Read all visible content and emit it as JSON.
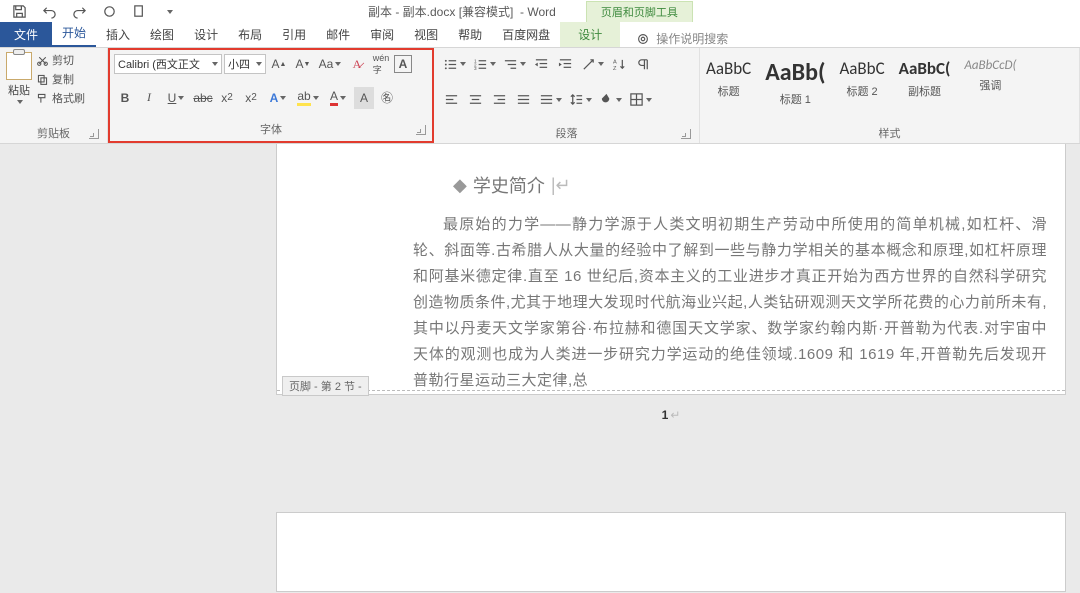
{
  "qat": {
    "save": "save-icon",
    "undo": "undo-icon",
    "redo": "redo-icon",
    "touch": "touch-icon",
    "new": "new-icon"
  },
  "titlebar": {
    "filename": "副本 - 副本.docx",
    "mode": "[兼容模式]",
    "app": "Word",
    "context_tool_group": "页眉和页脚工具"
  },
  "tabs": {
    "file": "文件",
    "home": "开始",
    "insert": "插入",
    "draw": "绘图",
    "design": "设计",
    "layout": "布局",
    "references": "引用",
    "mailings": "邮件",
    "review": "审阅",
    "view": "视图",
    "help": "帮助",
    "baidu": "百度网盘",
    "hf_design": "设计",
    "tell_me": "操作说明搜索"
  },
  "ribbon": {
    "clipboard": {
      "paste": "粘贴",
      "cut": "剪切",
      "copy": "复制",
      "painter": "格式刷",
      "label": "剪贴板"
    },
    "font": {
      "name": "Calibri (西文正文",
      "size": "小四",
      "grow": "A",
      "shrink": "A",
      "case": "Aa",
      "clear": "清",
      "pinyin": "拼",
      "border": "A",
      "bold": "B",
      "italic": "I",
      "underline": "U",
      "strike": "abc",
      "sub": "x₂",
      "sup": "x²",
      "effects": "A",
      "highlight": "ab",
      "color": "A",
      "shading": "A",
      "enclose": "㊦",
      "label": "字体"
    },
    "paragraph": {
      "bullets": "•",
      "numbers": "1.",
      "multilevel": "⊟",
      "indentL": "⇤",
      "indentR": "⇥",
      "sort": "↧",
      "marks": "¶",
      "alignL": "≡",
      "alignC": "≡",
      "alignR": "≡",
      "justify": "≡",
      "dist": "⊫",
      "linesp": "↕",
      "fill": "▦",
      "borders": "▢",
      "label": "段落"
    },
    "styles": {
      "items": [
        {
          "preview": "AaBbC",
          "name": "标题",
          "size": "17px",
          "weight": "400"
        },
        {
          "preview": "AaBb(",
          "name": "标题 1",
          "size": "24px",
          "weight": "700"
        },
        {
          "preview": "AaBbC",
          "name": "标题 2",
          "size": "17px",
          "weight": "400"
        },
        {
          "preview": "AaBbC(",
          "name": "副标题",
          "size": "17px",
          "weight": "700"
        },
        {
          "preview": "AaBbCcD(",
          "name": "强调",
          "size": "13px",
          "weight": "400",
          "style": "italic",
          "color": "#888"
        }
      ],
      "label": "样式"
    }
  },
  "document": {
    "heading": "学史简介",
    "body": "最原始的力学——静力学源于人类文明初期生产劳动中所使用的简单机械,如杠杆、滑轮、斜面等.古希腊人从大量的经验中了解到一些与静力学相关的基本概念和原理,如杠杆原理和阿基米德定律.直至 16 世纪后,资本主义的工业进步才真正开始为西方世界的自然科学研究创造物质条件,尤其于地理大发现时代航海业兴起,人类钻研观测天文学所花费的心力前所未有,其中以丹麦天文学家第谷·布拉赫和德国天文学家、数学家约翰内斯·开普勒为代表.对宇宙中天体的观测也成为人类进一步研究力学运动的绝佳领域.1609 和 1619 年,开普勒先后发现开普勒行星运动三大定律,总",
    "footer_tag": "页脚 - 第 2 节 -",
    "page_number": "1"
  }
}
